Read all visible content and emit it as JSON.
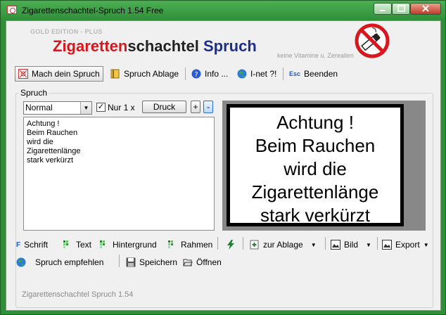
{
  "window": {
    "title": "Zigarettenschachtel-Spruch 1.54 Free"
  },
  "header": {
    "edition": "GOLD EDITION - PLUS",
    "title_part1": "Zigaretten",
    "title_part2": "schachtel ",
    "title_part3": "Spruch",
    "slogan": "keine Vitamine u. Zerealien"
  },
  "toolbar": {
    "make": "Mach dein Spruch",
    "storage": "Spruch Ablage",
    "info": "Info ...",
    "inet": "I-net ?!",
    "esc_key": "Esc",
    "quit": "Beenden"
  },
  "group": {
    "label": "Spruch"
  },
  "controls": {
    "style_value": "Normal",
    "only_once_checked": true,
    "only_once": "Nur 1 x",
    "print": "Druck",
    "plus": "+",
    "minus": "-"
  },
  "text_lines": [
    "Achtung !",
    "Beim Rauchen",
    "wird die",
    "Zigarettenlänge",
    "stark verkürzt"
  ],
  "preview_lines": [
    "Achtung !",
    "Beim Rauchen",
    "wird die",
    "Zigarettenlänge",
    "stark verkürzt"
  ],
  "bottom": {
    "font": "Schrift",
    "text": "Text",
    "background": "Hintergrund",
    "frame": "Rahmen",
    "to_storage": "zur Ablage",
    "image": "Bild",
    "export": "Export",
    "recommend": "Spruch empfehlen",
    "save": "Speichern",
    "open": "Öffnen"
  },
  "status": {
    "text": "Zigarettenschachtel Spruch 1.54"
  },
  "colors": {
    "brand_red": "#d8161d",
    "brand_blue": "#1d2f8c",
    "frame_green": "#2f8f39"
  }
}
